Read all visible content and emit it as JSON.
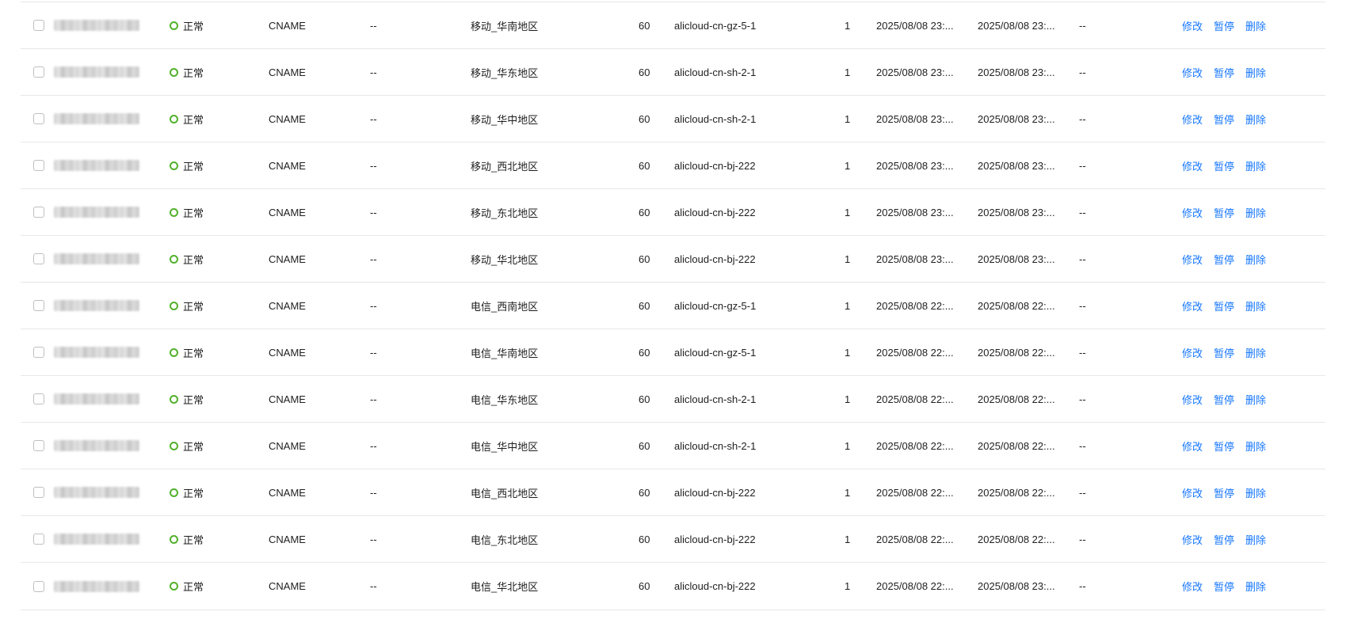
{
  "table": {
    "rows": [
      {
        "status": "正常",
        "type": "CNAME",
        "isp_line": "--",
        "line": "移动_华南地区",
        "ttl": "60",
        "value": "alicloud-cn-gz-5-1",
        "weight": "1",
        "created": "2025/08/08 23:...",
        "updated": "2025/08/08 23:...",
        "remark": "--"
      },
      {
        "status": "正常",
        "type": "CNAME",
        "isp_line": "--",
        "line": "移动_华东地区",
        "ttl": "60",
        "value": "alicloud-cn-sh-2-1",
        "weight": "1",
        "created": "2025/08/08 23:...",
        "updated": "2025/08/08 23:...",
        "remark": "--"
      },
      {
        "status": "正常",
        "type": "CNAME",
        "isp_line": "--",
        "line": "移动_华中地区",
        "ttl": "60",
        "value": "alicloud-cn-sh-2-1",
        "weight": "1",
        "created": "2025/08/08 23:...",
        "updated": "2025/08/08 23:...",
        "remark": "--"
      },
      {
        "status": "正常",
        "type": "CNAME",
        "isp_line": "--",
        "line": "移动_西北地区",
        "ttl": "60",
        "value": "alicloud-cn-bj-222",
        "weight": "1",
        "created": "2025/08/08 23:...",
        "updated": "2025/08/08 23:...",
        "remark": "--"
      },
      {
        "status": "正常",
        "type": "CNAME",
        "isp_line": "--",
        "line": "移动_东北地区",
        "ttl": "60",
        "value": "alicloud-cn-bj-222",
        "weight": "1",
        "created": "2025/08/08 23:...",
        "updated": "2025/08/08 23:...",
        "remark": "--"
      },
      {
        "status": "正常",
        "type": "CNAME",
        "isp_line": "--",
        "line": "移动_华北地区",
        "ttl": "60",
        "value": "alicloud-cn-bj-222",
        "weight": "1",
        "created": "2025/08/08 23:...",
        "updated": "2025/08/08 23:...",
        "remark": "--"
      },
      {
        "status": "正常",
        "type": "CNAME",
        "isp_line": "--",
        "line": "电信_西南地区",
        "ttl": "60",
        "value": "alicloud-cn-gz-5-1",
        "weight": "1",
        "created": "2025/08/08 22:...",
        "updated": "2025/08/08 22:...",
        "remark": "--"
      },
      {
        "status": "正常",
        "type": "CNAME",
        "isp_line": "--",
        "line": "电信_华南地区",
        "ttl": "60",
        "value": "alicloud-cn-gz-5-1",
        "weight": "1",
        "created": "2025/08/08 22:...",
        "updated": "2025/08/08 22:...",
        "remark": "--"
      },
      {
        "status": "正常",
        "type": "CNAME",
        "isp_line": "--",
        "line": "电信_华东地区",
        "ttl": "60",
        "value": "alicloud-cn-sh-2-1",
        "weight": "1",
        "created": "2025/08/08 22:...",
        "updated": "2025/08/08 22:...",
        "remark": "--"
      },
      {
        "status": "正常",
        "type": "CNAME",
        "isp_line": "--",
        "line": "电信_华中地区",
        "ttl": "60",
        "value": "alicloud-cn-sh-2-1",
        "weight": "1",
        "created": "2025/08/08 22:...",
        "updated": "2025/08/08 22:...",
        "remark": "--"
      },
      {
        "status": "正常",
        "type": "CNAME",
        "isp_line": "--",
        "line": "电信_西北地区",
        "ttl": "60",
        "value": "alicloud-cn-bj-222",
        "weight": "1",
        "created": "2025/08/08 22:...",
        "updated": "2025/08/08 22:...",
        "remark": "--"
      },
      {
        "status": "正常",
        "type": "CNAME",
        "isp_line": "--",
        "line": "电信_东北地区",
        "ttl": "60",
        "value": "alicloud-cn-bj-222",
        "weight": "1",
        "created": "2025/08/08 22:...",
        "updated": "2025/08/08 22:...",
        "remark": "--"
      },
      {
        "status": "正常",
        "type": "CNAME",
        "isp_line": "--",
        "line": "电信_华北地区",
        "ttl": "60",
        "value": "alicloud-cn-bj-222",
        "weight": "1",
        "created": "2025/08/08 22:...",
        "updated": "2025/08/08 23:...",
        "remark": "--"
      }
    ],
    "actions": {
      "edit_label": "修改",
      "pause_label": "暂停",
      "delete_label": "删除"
    }
  },
  "colors": {
    "status_ok": "#52b12c",
    "link": "#1677ff",
    "divider": "#e8e8e8"
  }
}
